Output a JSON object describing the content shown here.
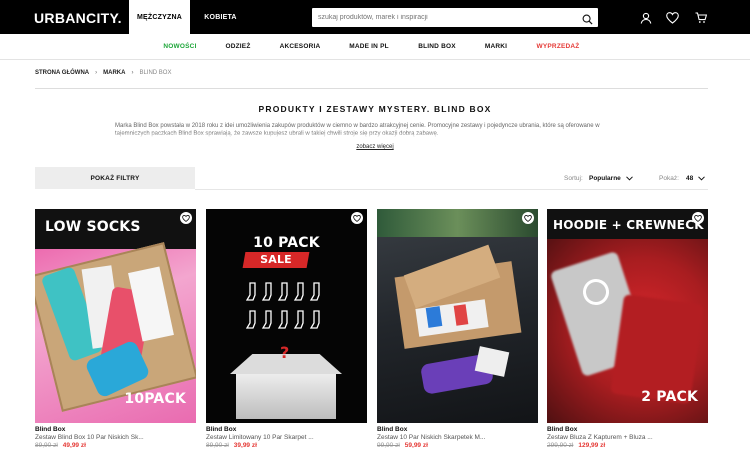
{
  "header": {
    "logo": "URBANCITY.",
    "gender_tabs": [
      {
        "label": "MĘŻCZYZNA",
        "active": true
      },
      {
        "label": "KOBIETA",
        "active": false
      }
    ],
    "search_placeholder": "szukaj produktów, marek i inspiracji",
    "icons": [
      "search-icon",
      "user-icon",
      "heart-icon",
      "cart-icon"
    ]
  },
  "nav": {
    "items": [
      {
        "label": "NOWOŚCI",
        "color": "#1ea63a"
      },
      {
        "label": "ODZIEŻ",
        "color": "#111111"
      },
      {
        "label": "AKCESORIA",
        "color": "#111111"
      },
      {
        "label": "MADE IN PL",
        "color": "#111111"
      },
      {
        "label": "BLIND BOX",
        "color": "#111111"
      },
      {
        "label": "MARKI",
        "color": "#111111"
      },
      {
        "label": "WYPRZEDAŻ",
        "color": "#e53935"
      }
    ]
  },
  "breadcrumb": {
    "items": [
      "STRONA GŁÓWNA",
      "MARKA"
    ],
    "current": "BLIND BOX"
  },
  "page": {
    "title": "PRODUKTY I ZESTAWY MYSTERY. BLIND BOX",
    "description": "Marka Blind Box powstała w 2018 roku z idei umożliwienia zakupów produktów w ciemno w bardzo atrakcyjnej cenie. Promocyjne zestawy i pojedyncze ubrania, które są oferowane w tajemniczych paczkach Blind Box sprawiają, że zawsze kupujesz ubrali w takiej chwili stroje się przy okazji dobrą zabawę.",
    "more_link": "zobacz więcej"
  },
  "toolbar": {
    "filters_label": "POKAŻ FILTRY",
    "sort_label": "Sortuj:",
    "sort_value": "Popularne",
    "show_label": "Pokaż:",
    "show_value": "48"
  },
  "products": [
    {
      "brand": "Blind Box",
      "name": "Zestaw Blind Box 10 Par Niskich Sk...",
      "old_price": "89,90 zł",
      "new_price": "49,99 zł",
      "overlay_top": "LOW SOCKS",
      "overlay_bottom": "10PACK"
    },
    {
      "brand": "Blind Box",
      "name": "Zestaw Limitowany 10 Par Skarpet ...",
      "old_price": "89,90 zł",
      "new_price": "39,99 zł",
      "overlay_top": "10 PACK",
      "overlay_badge": "SALE"
    },
    {
      "brand": "Blind Box",
      "name": "Zestaw 10 Par Niskich Skarpetek M...",
      "old_price": "99,90 zł",
      "new_price": "59,99 zł"
    },
    {
      "brand": "Blind Box",
      "name": "Zestaw Bluza Z Kapturem + Bluza ...",
      "old_price": "299,90 zł",
      "new_price": "129,99 zł",
      "overlay_top": "HOODIE + CREWNECK",
      "overlay_bottom": "2 PACK"
    }
  ],
  "colors": {
    "accent_green": "#1ea63a",
    "sale_red": "#e53935",
    "header_bg": "#000000"
  }
}
